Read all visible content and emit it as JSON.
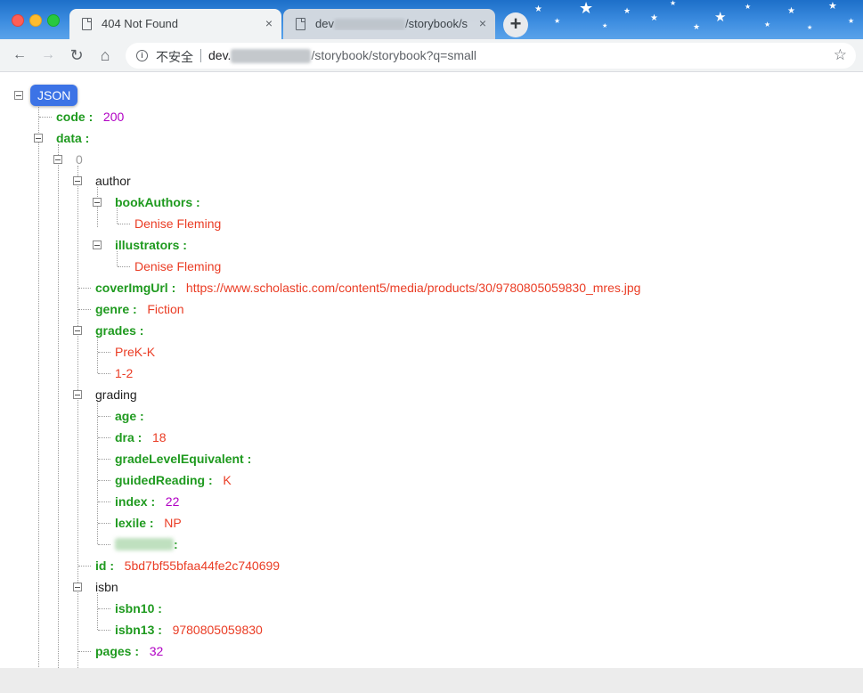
{
  "tabs": [
    {
      "title": "404 Not Found",
      "close": "×"
    },
    {
      "title_prefix": "dev",
      "title_suffix": "/storybook/s",
      "close": "×"
    }
  ],
  "new_tab": "+",
  "toolbar": {
    "back": "←",
    "forward": "→",
    "reload": "↻",
    "home": "⌂",
    "info": "i",
    "security_label": "不安全",
    "url_host": "dev.",
    "url_path": "/storybook/storybook?q=small",
    "bookmark": "☆"
  },
  "viewer": {
    "root_badge": "JSON",
    "rows": {
      "code_key": "code :",
      "code_val": "200",
      "data_key": "data :",
      "idx0": "0",
      "author": "author",
      "bookAuthors_key": "bookAuthors :",
      "bookAuthors_val": "Denise Fleming",
      "illustrators_key": "illustrators :",
      "illustrators_val": "Denise Fleming",
      "cover_key": "coverImgUrl :",
      "cover_val": "https://www.scholastic.com/content5/media/products/30/9780805059830_mres.jpg",
      "genre_key": "genre :",
      "genre_val": "Fiction",
      "grades_key": "grades :",
      "grades_v1": "PreK-K",
      "grades_v2": "1-2",
      "grading": "grading",
      "age_key": "age :",
      "dra_key": "dra :",
      "dra_val": "18",
      "gle_key": "gradeLevelEquivalent :",
      "guided_key": "guidedReading :",
      "guided_val": "K",
      "index_key": "index :",
      "index_val": "22",
      "lexile_key": "lexile :",
      "lexile_val": "NP",
      "hidden_colon": ":",
      "id_key": "id :",
      "id_val": "5bd7bf55bfaa44fe2c740699",
      "isbn": "isbn",
      "isbn10_key": "isbn10 :",
      "isbn13_key": "isbn13 :",
      "isbn13_val": "9780805059830",
      "pages_key": "pages :",
      "pages_val": "32"
    }
  },
  "colors": {
    "key": "#1f9a1f",
    "number": "#b100c4",
    "string": "#ea3c24",
    "badge": "#3c73e6"
  }
}
